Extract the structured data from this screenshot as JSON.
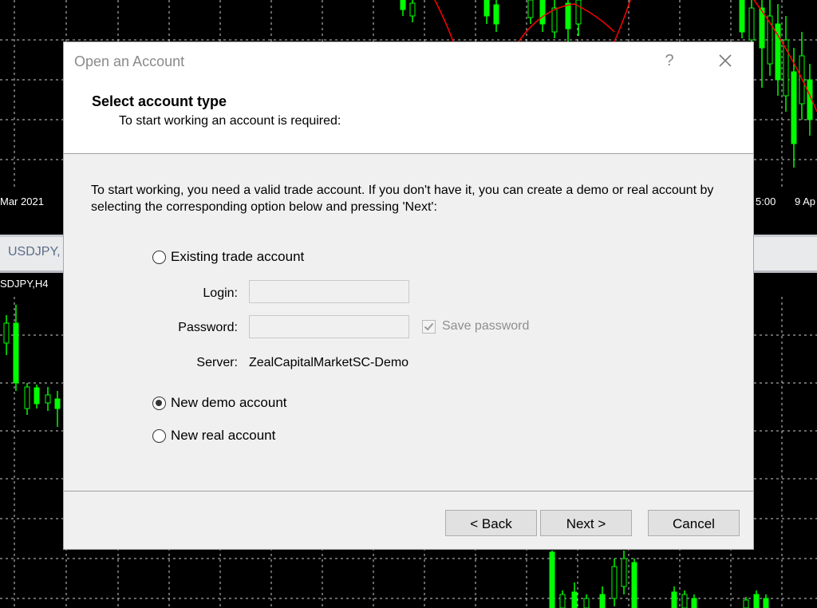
{
  "background_chart": {
    "top_left_date": "Mar 2021",
    "top_right_time": "5:00",
    "top_right_date": "9 Ap",
    "tab_label": "USDJPY,",
    "chart_label": "SDJPY,H4",
    "colors": {
      "background": "#000000",
      "grid": "#ffffff",
      "candles": "#00ff00",
      "moving_average": "#ff0000"
    }
  },
  "dialog": {
    "title": "Open an Account",
    "help_icon": "question-icon",
    "close_icon": "close-icon",
    "heading": "Select account type",
    "subheading": "To start working an account is required:",
    "intro_text": "To start working, you need a valid trade account. If you don't have it, you can create a demo or real account by selecting the corresponding option below and pressing 'Next':",
    "options": {
      "existing": "Existing trade account",
      "demo": "New demo account",
      "real": "New real account"
    },
    "selected_option": "demo",
    "login_label": "Login:",
    "login_value": "",
    "password_label": "Password:",
    "password_value": "",
    "save_password_label": "Save password",
    "save_password_checked": true,
    "server_label": "Server:",
    "server_value": "ZealCapitalMarketSC-Demo",
    "buttons": {
      "back": "< Back",
      "next": "Next >",
      "cancel": "Cancel"
    }
  }
}
